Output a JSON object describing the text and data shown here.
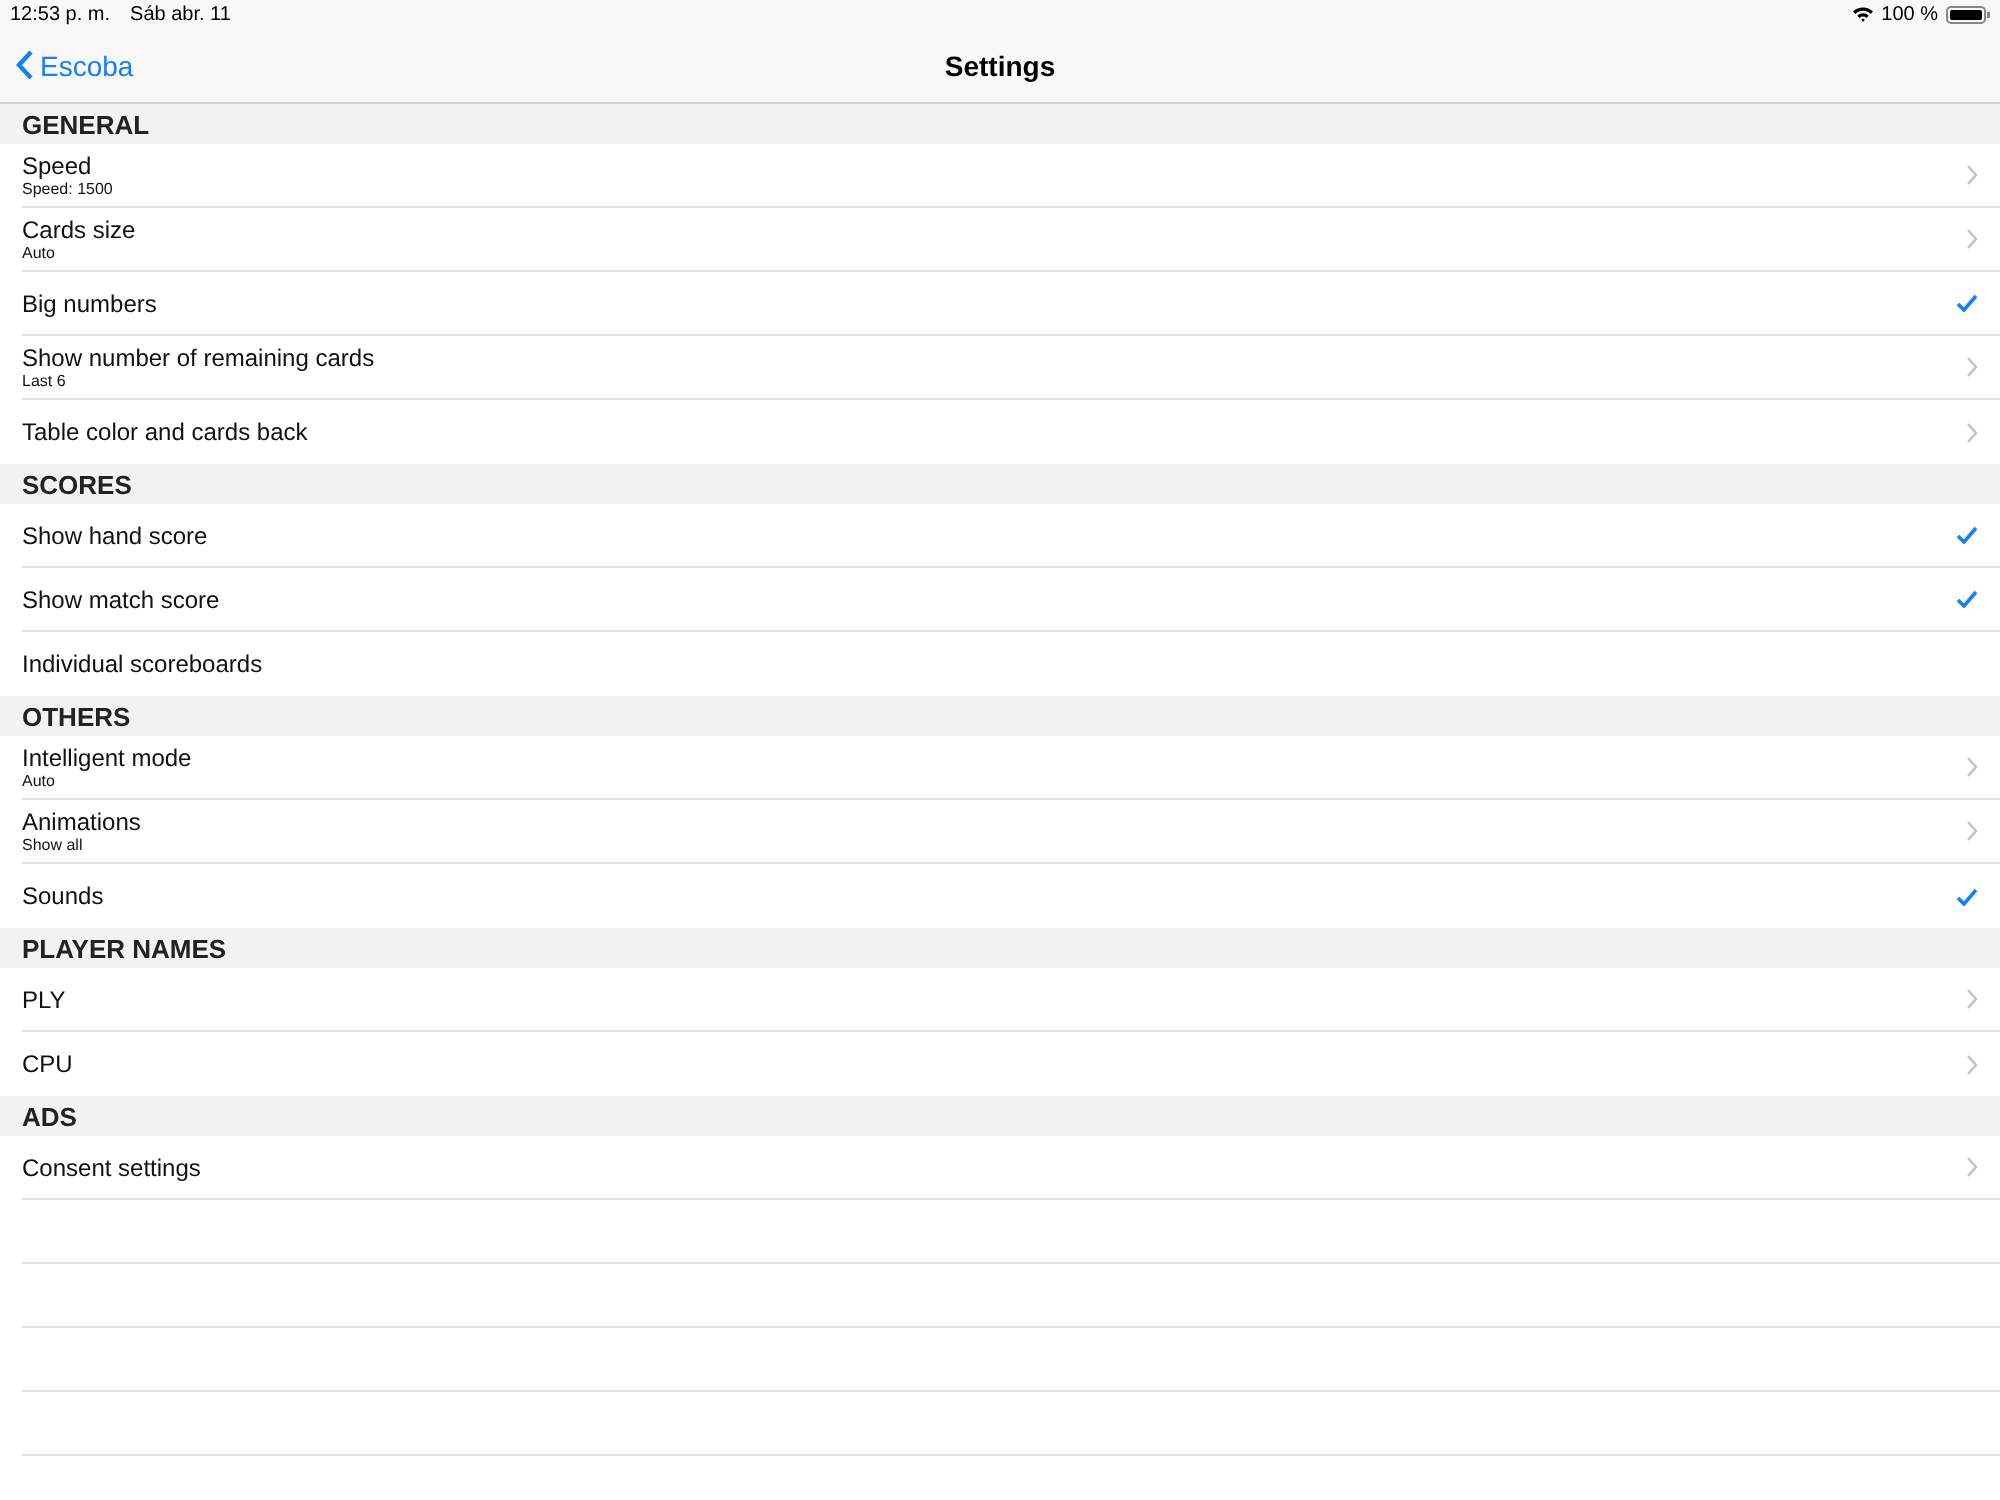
{
  "status_bar": {
    "time": "12:53 p. m.",
    "date": "Sáb abr. 11",
    "battery": "100 %"
  },
  "nav": {
    "back": "Escoba",
    "title": "Settings"
  },
  "sections": [
    {
      "title": "GENERAL",
      "rows": [
        {
          "kind": "link",
          "label": "Speed",
          "detail": "Speed: 1500"
        },
        {
          "kind": "link",
          "label": "Cards size",
          "detail": "Auto"
        },
        {
          "kind": "check",
          "label": "Big numbers",
          "checked": true
        },
        {
          "kind": "link",
          "label": "Show number of remaining cards",
          "detail": "Last 6"
        },
        {
          "kind": "link",
          "label": "Table color and cards back"
        }
      ]
    },
    {
      "title": "SCORES",
      "rows": [
        {
          "kind": "check",
          "label": "Show hand score",
          "checked": true
        },
        {
          "kind": "check",
          "label": "Show match score",
          "checked": true
        },
        {
          "kind": "check",
          "label": "Individual scoreboards",
          "checked": false
        }
      ]
    },
    {
      "title": "OTHERS",
      "rows": [
        {
          "kind": "link",
          "label": "Intelligent mode",
          "detail": "Auto"
        },
        {
          "kind": "link",
          "label": "Animations",
          "detail": "Show all"
        },
        {
          "kind": "check",
          "label": "Sounds",
          "checked": true
        }
      ]
    },
    {
      "title": "PLAYER NAMES",
      "rows": [
        {
          "kind": "link",
          "label": "PLY"
        },
        {
          "kind": "link",
          "label": "CPU"
        }
      ]
    },
    {
      "title": "ADS",
      "rows": [
        {
          "kind": "link",
          "label": "Consent settings"
        }
      ]
    }
  ]
}
